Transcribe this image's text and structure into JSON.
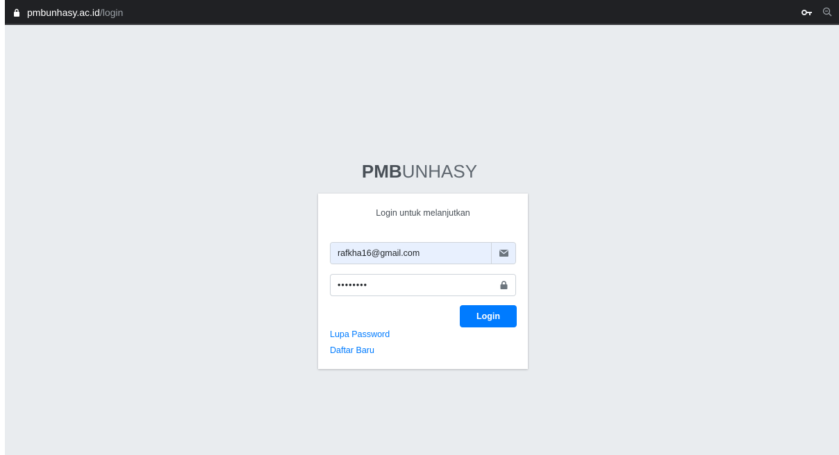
{
  "browser": {
    "url_host": "pmbunhasy.ac.id",
    "url_path": "/login",
    "icons": [
      "lock-icon",
      "key-icon",
      "zoom-icon"
    ]
  },
  "brand": {
    "bold": "PMB",
    "light": "UNHASY"
  },
  "login_card": {
    "message": "Login untuk melanjutkan",
    "email": {
      "value": "rafkha16@gmail.com",
      "icon": "envelope-icon"
    },
    "password": {
      "value": "••••••••",
      "icon": "lock-icon"
    },
    "login_label": "Login",
    "forgot_label": "Lupa Password",
    "register_label": "Daftar Baru"
  },
  "colors": {
    "background": "#e9ecef",
    "primary": "#007bff",
    "autofill": "#e8f0fe"
  }
}
